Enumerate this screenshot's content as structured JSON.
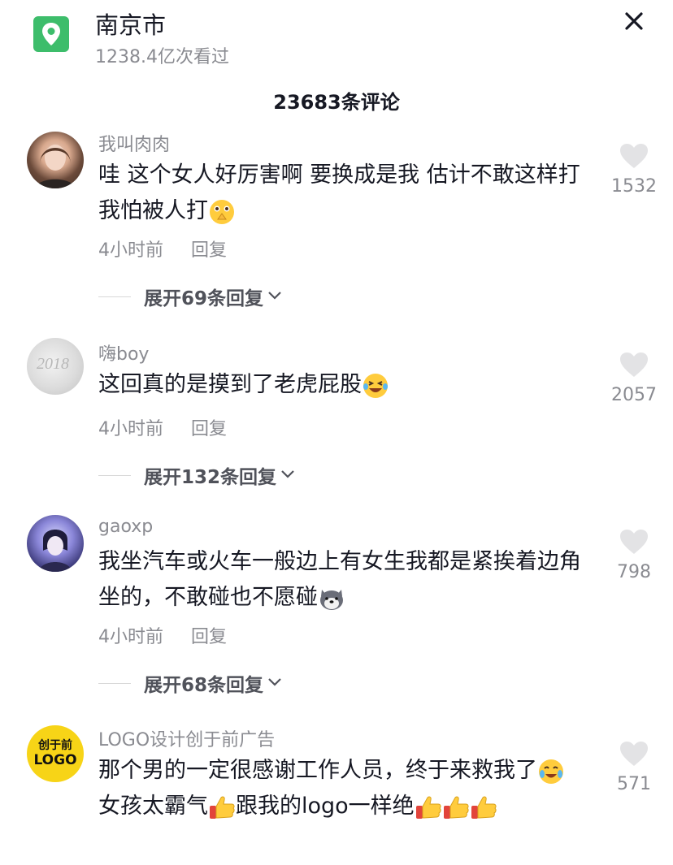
{
  "header": {
    "title": "南京市",
    "subtitle": "1238.4亿次看过",
    "accent": "#3dbd6b",
    "icon": "location-pin-icon",
    "close_icon": "close-icon"
  },
  "comments_title": "23683条评论",
  "comments": [
    {
      "username": "我叫肉肉",
      "text": "哇 这个女人好厉害啊 要换成是我 估计不敢这样打 我怕被人打",
      "emojis": [
        "praying-face-emoji"
      ],
      "time": "4小时前",
      "reply_label": "回复",
      "expand_label": "展开69条回复",
      "likes": "1532"
    },
    {
      "username": "嗨boy",
      "text": "这回真的是摸到了老虎屁股",
      "emojis": [
        "laughing-tears-emoji"
      ],
      "time": "4小时前",
      "reply_label": "回复",
      "expand_label": "展开132条回复",
      "likes": "2057"
    },
    {
      "username": "gaoxp",
      "text": "我坐汽车或火车一般边上有女生我都是紧挨着边角坐的，不敢碰也不愿碰",
      "emojis": [
        "husky-dog-emoji"
      ],
      "time": "4小时前",
      "reply_label": "回复",
      "expand_label": "展开68条回复",
      "likes": "798"
    },
    {
      "username": "LOGO设计创于前广告",
      "avatar_text_top": "创于前",
      "avatar_text_bottom": "LOGO",
      "text_parts": [
        "那个男的一定很感谢工作人员，终于来救我了",
        "女孩太霸气",
        "跟我的logo一样绝",
        ""
      ],
      "emojis": [
        "crying-laughing-emoji",
        "thumbs-up-emoji",
        "thumbs-up-emoji",
        "thumbs-up-emoji",
        "thumbs-up-emoji"
      ],
      "likes": "571"
    }
  ]
}
